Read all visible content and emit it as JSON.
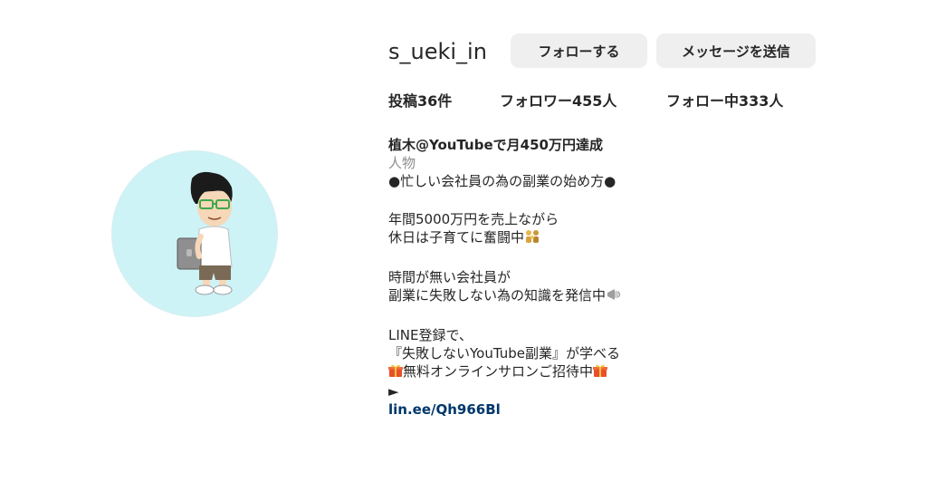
{
  "profile": {
    "username": "s_ueki_in",
    "follow_label": "フォローする",
    "message_label": "メッセージを送信"
  },
  "stats": {
    "posts": "投稿36件",
    "followers": "フォロワー455人",
    "following": "フォロー中333人"
  },
  "bio": {
    "name": "植木@YouTubeで月450万円達成",
    "category": "人物",
    "line1": "●忙しい会社員の為の副業の始め方●",
    "line2": "年間5000万円を売上ながら",
    "line3": "休日は子育てに奮闘中",
    "line4": "時間が無い会社員が",
    "line5": "副業に失敗しない為の知識を発信中",
    "line6": "LINE登録で、",
    "line7": "『失敗しないYouTube副業』が学べる",
    "line8": "無料オンラインサロンご招待中",
    "line9": "►",
    "link": "lin.ee/Qh966Bl"
  },
  "icons": {
    "family": "family-emoji-icon",
    "megaphone": "megaphone-emoji-icon",
    "gift": "gift-emoji-icon"
  }
}
